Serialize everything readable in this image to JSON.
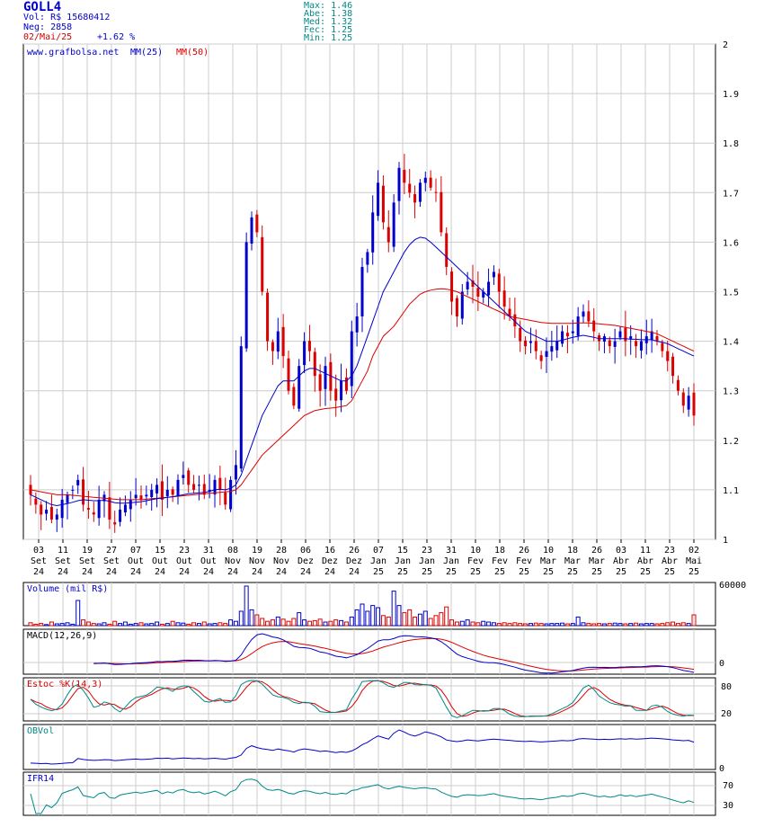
{
  "header": {
    "ticker": "GOLL4",
    "vol_label": "Vol:",
    "vol_value": "R$ 15680412",
    "neg_label": "Neg:",
    "neg_value": "2858",
    "date": "02/Mai/25",
    "change": "+1.62 %",
    "stats": [
      {
        "label": "Max:",
        "value": "1.46"
      },
      {
        "label": "Abe:",
        "value": "1.38"
      },
      {
        "label": "Med:",
        "value": "1.32"
      },
      {
        "label": "Fec:",
        "value": "1.25"
      },
      {
        "label": "Min:",
        "value": "1.25"
      }
    ]
  },
  "legend": {
    "site": "www.grafbolsa.net",
    "ma25": "MM(25)",
    "ma50": "MM(50)"
  },
  "colors": {
    "up": "#0000cc",
    "down": "#dd0000",
    "ma25": "#0000cc",
    "ma50": "#dd0000",
    "grid": "#cccccc",
    "teal": "#008888"
  },
  "chart_data": [
    {
      "type": "candlestick",
      "title": "GOLL4",
      "ylim": [
        1.0,
        2.0
      ],
      "y_ticks": [
        "1",
        "1.1",
        "1.2",
        "1.3",
        "1.4",
        "1.5",
        "1.6",
        "1.7",
        "1.8",
        "1.9",
        "2"
      ],
      "x_ticks": [
        {
          "day": "03",
          "mon": "Set",
          "yr": "24"
        },
        {
          "day": "11",
          "mon": "Set",
          "yr": "24"
        },
        {
          "day": "19",
          "mon": "Set",
          "yr": "24"
        },
        {
          "day": "27",
          "mon": "Set",
          "yr": "24"
        },
        {
          "day": "07",
          "mon": "Out",
          "yr": "24"
        },
        {
          "day": "15",
          "mon": "Out",
          "yr": "24"
        },
        {
          "day": "23",
          "mon": "Out",
          "yr": "24"
        },
        {
          "day": "31",
          "mon": "Out",
          "yr": "24"
        },
        {
          "day": "08",
          "mon": "Nov",
          "yr": "24"
        },
        {
          "day": "19",
          "mon": "Nov",
          "yr": "24"
        },
        {
          "day": "28",
          "mon": "Nov",
          "yr": "24"
        },
        {
          "day": "06",
          "mon": "Dez",
          "yr": "24"
        },
        {
          "day": "16",
          "mon": "Dez",
          "yr": "24"
        },
        {
          "day": "26",
          "mon": "Dez",
          "yr": "24"
        },
        {
          "day": "07",
          "mon": "Jan",
          "yr": "25"
        },
        {
          "day": "15",
          "mon": "Jan",
          "yr": "25"
        },
        {
          "day": "23",
          "mon": "Jan",
          "yr": "25"
        },
        {
          "day": "31",
          "mon": "Jan",
          "yr": "25"
        },
        {
          "day": "10",
          "mon": "Fev",
          "yr": "25"
        },
        {
          "day": "18",
          "mon": "Fev",
          "yr": "25"
        },
        {
          "day": "26",
          "mon": "Fev",
          "yr": "25"
        },
        {
          "day": "10",
          "mon": "Mar",
          "yr": "25"
        },
        {
          "day": "18",
          "mon": "Mar",
          "yr": "25"
        },
        {
          "day": "26",
          "mon": "Mar",
          "yr": "25"
        },
        {
          "day": "03",
          "mon": "Abr",
          "yr": "25"
        },
        {
          "day": "11",
          "mon": "Abr",
          "yr": "25"
        },
        {
          "day": "23",
          "mon": "Abr",
          "yr": "25"
        },
        {
          "day": "02",
          "mon": "Mai",
          "yr": "25"
        }
      ],
      "close_path": [
        1.09,
        1.07,
        1.05,
        1.06,
        1.04,
        1.05,
        1.08,
        1.09,
        1.1,
        1.12,
        1.07,
        1.06,
        1.05,
        1.08,
        1.09,
        1.04,
        1.03,
        1.06,
        1.07,
        1.08,
        1.09,
        1.08,
        1.09,
        1.1,
        1.11,
        1.08,
        1.1,
        1.09,
        1.12,
        1.13,
        1.11,
        1.1,
        1.11,
        1.09,
        1.1,
        1.12,
        1.1,
        1.07,
        1.12,
        1.15,
        1.39,
        1.6,
        1.65,
        1.62,
        1.5,
        1.4,
        1.38,
        1.42,
        1.37,
        1.3,
        1.27,
        1.35,
        1.4,
        1.38,
        1.33,
        1.3,
        1.35,
        1.3,
        1.28,
        1.32,
        1.3,
        1.42,
        1.45,
        1.55,
        1.58,
        1.66,
        1.72,
        1.64,
        1.6,
        1.68,
        1.75,
        1.72,
        1.7,
        1.68,
        1.72,
        1.73,
        1.71,
        1.7,
        1.62,
        1.55,
        1.48,
        1.45,
        1.5,
        1.52,
        1.51,
        1.49,
        1.5,
        1.52,
        1.54,
        1.5,
        1.47,
        1.45,
        1.43,
        1.4,
        1.39,
        1.4,
        1.38,
        1.36,
        1.38,
        1.39,
        1.4,
        1.42,
        1.41,
        1.42,
        1.45,
        1.46,
        1.44,
        1.42,
        1.4,
        1.41,
        1.39,
        1.4,
        1.42,
        1.4,
        1.41,
        1.39,
        1.4,
        1.41,
        1.42,
        1.4,
        1.38,
        1.36,
        1.33,
        1.3,
        1.27,
        1.29,
        1.25
      ],
      "ma25_path": [
        1.09,
        1.085,
        1.08,
        1.075,
        1.07,
        1.068,
        1.07,
        1.072,
        1.075,
        1.078,
        1.08,
        1.079,
        1.078,
        1.078,
        1.079,
        1.077,
        1.074,
        1.073,
        1.073,
        1.074,
        1.075,
        1.076,
        1.078,
        1.08,
        1.082,
        1.083,
        1.085,
        1.086,
        1.088,
        1.09,
        1.092,
        1.093,
        1.094,
        1.095,
        1.097,
        1.1,
        1.101,
        1.1,
        1.103,
        1.11,
        1.13,
        1.16,
        1.19,
        1.22,
        1.25,
        1.27,
        1.29,
        1.31,
        1.32,
        1.32,
        1.32,
        1.33,
        1.34,
        1.345,
        1.345,
        1.34,
        1.335,
        1.33,
        1.325,
        1.32,
        1.32,
        1.33,
        1.35,
        1.38,
        1.41,
        1.44,
        1.47,
        1.5,
        1.52,
        1.54,
        1.56,
        1.58,
        1.595,
        1.605,
        1.61,
        1.608,
        1.6,
        1.59,
        1.58,
        1.57,
        1.56,
        1.55,
        1.54,
        1.53,
        1.52,
        1.51,
        1.5,
        1.49,
        1.48,
        1.47,
        1.46,
        1.45,
        1.44,
        1.43,
        1.42,
        1.415,
        1.41,
        1.405,
        1.4,
        1.4,
        1.4,
        1.402,
        1.405,
        1.408,
        1.41,
        1.412,
        1.41,
        1.408,
        1.405,
        1.405,
        1.405,
        1.405,
        1.405,
        1.405,
        1.404,
        1.404,
        1.403,
        1.403,
        1.403,
        1.4,
        1.398,
        1.395,
        1.39,
        1.385,
        1.38,
        1.375,
        1.37
      ],
      "ma50_path": [
        1.1,
        1.098,
        1.096,
        1.094,
        1.092,
        1.09,
        1.09,
        1.09,
        1.089,
        1.088,
        1.087,
        1.086,
        1.085,
        1.084,
        1.083,
        1.082,
        1.081,
        1.08,
        1.08,
        1.08,
        1.08,
        1.08,
        1.081,
        1.082,
        1.083,
        1.084,
        1.085,
        1.086,
        1.087,
        1.088,
        1.089,
        1.09,
        1.091,
        1.092,
        1.093,
        1.094,
        1.095,
        1.096,
        1.097,
        1.1,
        1.11,
        1.125,
        1.14,
        1.155,
        1.17,
        1.18,
        1.19,
        1.2,
        1.21,
        1.22,
        1.23,
        1.24,
        1.25,
        1.255,
        1.26,
        1.262,
        1.264,
        1.265,
        1.266,
        1.268,
        1.27,
        1.28,
        1.3,
        1.32,
        1.34,
        1.37,
        1.39,
        1.41,
        1.42,
        1.43,
        1.445,
        1.46,
        1.475,
        1.485,
        1.495,
        1.5,
        1.503,
        1.505,
        1.506,
        1.505,
        1.503,
        1.5,
        1.495,
        1.49,
        1.485,
        1.48,
        1.475,
        1.47,
        1.465,
        1.46,
        1.455,
        1.45,
        1.448,
        1.446,
        1.444,
        1.442,
        1.44,
        1.438,
        1.437,
        1.436,
        1.436,
        1.436,
        1.436,
        1.436,
        1.437,
        1.437,
        1.437,
        1.436,
        1.435,
        1.434,
        1.433,
        1.432,
        1.43,
        1.428,
        1.426,
        1.424,
        1.422,
        1.42,
        1.418,
        1.415,
        1.41,
        1.405,
        1.4,
        1.395,
        1.39,
        1.385,
        1.38
      ]
    },
    {
      "type": "bar",
      "name_label": "Volume (mil R$)",
      "ylim": [
        0,
        60000
      ],
      "y_ticks": [
        "60000"
      ],
      "values": [
        4000,
        2000,
        3000,
        1500,
        5000,
        2500,
        3000,
        4000,
        2000,
        35000,
        8000,
        5000,
        3000,
        2500,
        4000,
        2000,
        6000,
        3000,
        5000,
        2000,
        3000,
        4000,
        2500,
        3000,
        5000,
        2000,
        3000,
        6000,
        4000,
        3500,
        2000,
        4000,
        3000,
        5000,
        2500,
        3000,
        4000,
        3000,
        8000,
        6000,
        20000,
        55000,
        22000,
        15000,
        10000,
        6000,
        8000,
        12000,
        9000,
        6000,
        10000,
        18000,
        8000,
        6000,
        7000,
        9000,
        5000,
        6000,
        8000,
        7000,
        5000,
        12000,
        22000,
        30000,
        20000,
        28000,
        25000,
        14000,
        12000,
        48000,
        28000,
        18000,
        22000,
        12000,
        16000,
        20000,
        10000,
        14000,
        18000,
        26000,
        8000,
        5000,
        6000,
        8000,
        5000,
        4000,
        6000,
        5000,
        4000,
        3000,
        4000,
        3000,
        4000,
        3000,
        2500,
        3000,
        3500,
        3000,
        2500,
        3000,
        3000,
        3500,
        2500,
        3000,
        12000,
        4000,
        3000,
        2500,
        3000,
        2500,
        3000,
        3500,
        3000,
        2500,
        3000,
        3500,
        2500,
        3000,
        3000,
        2500,
        3000,
        4000,
        5000,
        3000,
        4000,
        3000,
        15000
      ]
    },
    {
      "type": "line",
      "name_label": "MACD(12,26,9)",
      "y_ticks": [
        "0"
      ]
    },
    {
      "type": "line",
      "name_label": "Estoc %K(14,3)",
      "ylim": [
        0,
        100
      ],
      "y_ticks": [
        "80",
        "20"
      ]
    },
    {
      "type": "line",
      "name_label": "OBVol",
      "y_ticks": [
        "0"
      ]
    },
    {
      "type": "line",
      "name_label": "IFR14",
      "ylim": [
        0,
        100
      ],
      "y_ticks": [
        "70",
        "30"
      ]
    }
  ]
}
